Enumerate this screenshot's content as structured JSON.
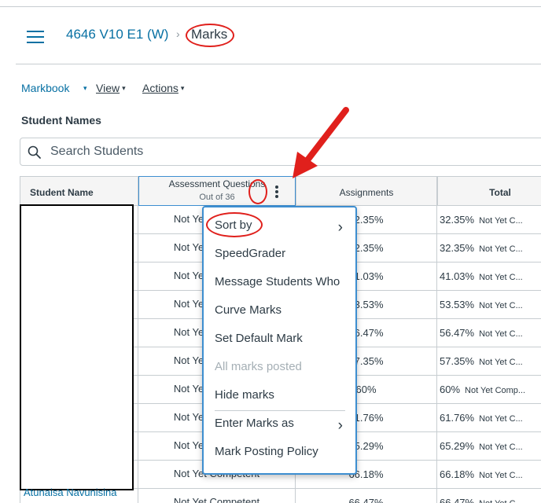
{
  "breadcrumb": {
    "course": "4646 V10 E1 (W)",
    "separator": "›",
    "current": "Marks"
  },
  "menubar": {
    "markbook": "Markbook",
    "view": "View",
    "actions": "Actions",
    "caret": "▾"
  },
  "section_label": "Student Names",
  "search": {
    "placeholder": "Search Students",
    "value": ""
  },
  "columns": {
    "student_name": "Student Name",
    "assessment": "Assessment Questions",
    "assessment_sub": "Out of 36",
    "assignments": "Assignments",
    "total": "Total"
  },
  "rows": [
    {
      "aq": "Not Yet Competent",
      "asg": "32.35%",
      "total": "32.35%",
      "status": "Not Yet C..."
    },
    {
      "aq": "Not Yet Competent",
      "asg": "32.35%",
      "total": "32.35%",
      "status": "Not Yet C..."
    },
    {
      "aq": "Not Yet Competent",
      "asg": "41.03%",
      "total": "41.03%",
      "status": "Not Yet C..."
    },
    {
      "aq": "Not Yet Competent",
      "asg": "53.53%",
      "total": "53.53%",
      "status": "Not Yet C..."
    },
    {
      "aq": "Not Yet Competent",
      "asg": "56.47%",
      "total": "56.47%",
      "status": "Not Yet C..."
    },
    {
      "aq": "Not Yet Competent",
      "asg": "57.35%",
      "total": "57.35%",
      "status": "Not Yet C..."
    },
    {
      "aq": "Not Yet Competent",
      "asg": "60%",
      "total": "60%",
      "status": "Not Yet Comp..."
    },
    {
      "aq": "Not Yet Competent",
      "asg": "61.76%",
      "total": "61.76%",
      "status": "Not Yet C..."
    },
    {
      "aq": "Not Yet Competent",
      "asg": "65.29%",
      "total": "65.29%",
      "status": "Not Yet C..."
    },
    {
      "aq": "Not Yet Competent",
      "asg": "66.18%",
      "total": "66.18%",
      "status": "Not Yet C..."
    },
    {
      "aq": "Not Yet Competent",
      "asg": "66.47%",
      "total": "66.47%",
      "status": "Not Yet C..."
    }
  ],
  "visible_student_name": "Atunaisa Navunisina",
  "column_menu": {
    "items": [
      {
        "label": "Sort by",
        "submenu": true
      },
      {
        "label": "SpeedGrader"
      },
      {
        "label": "Message Students Who"
      },
      {
        "label": "Curve Marks"
      },
      {
        "label": "Set Default Mark"
      },
      {
        "label": "All marks posted",
        "disabled": true
      },
      {
        "label": "Hide marks"
      },
      {
        "label": "Enter Marks as",
        "submenu": true
      },
      {
        "label": "Mark Posting Policy"
      }
    ],
    "submenu_arrow": "›"
  },
  "colors": {
    "link": "#0770a3",
    "text": "#2d3b45",
    "annotation": "#e0201c",
    "focus": "#3d8ed0"
  }
}
